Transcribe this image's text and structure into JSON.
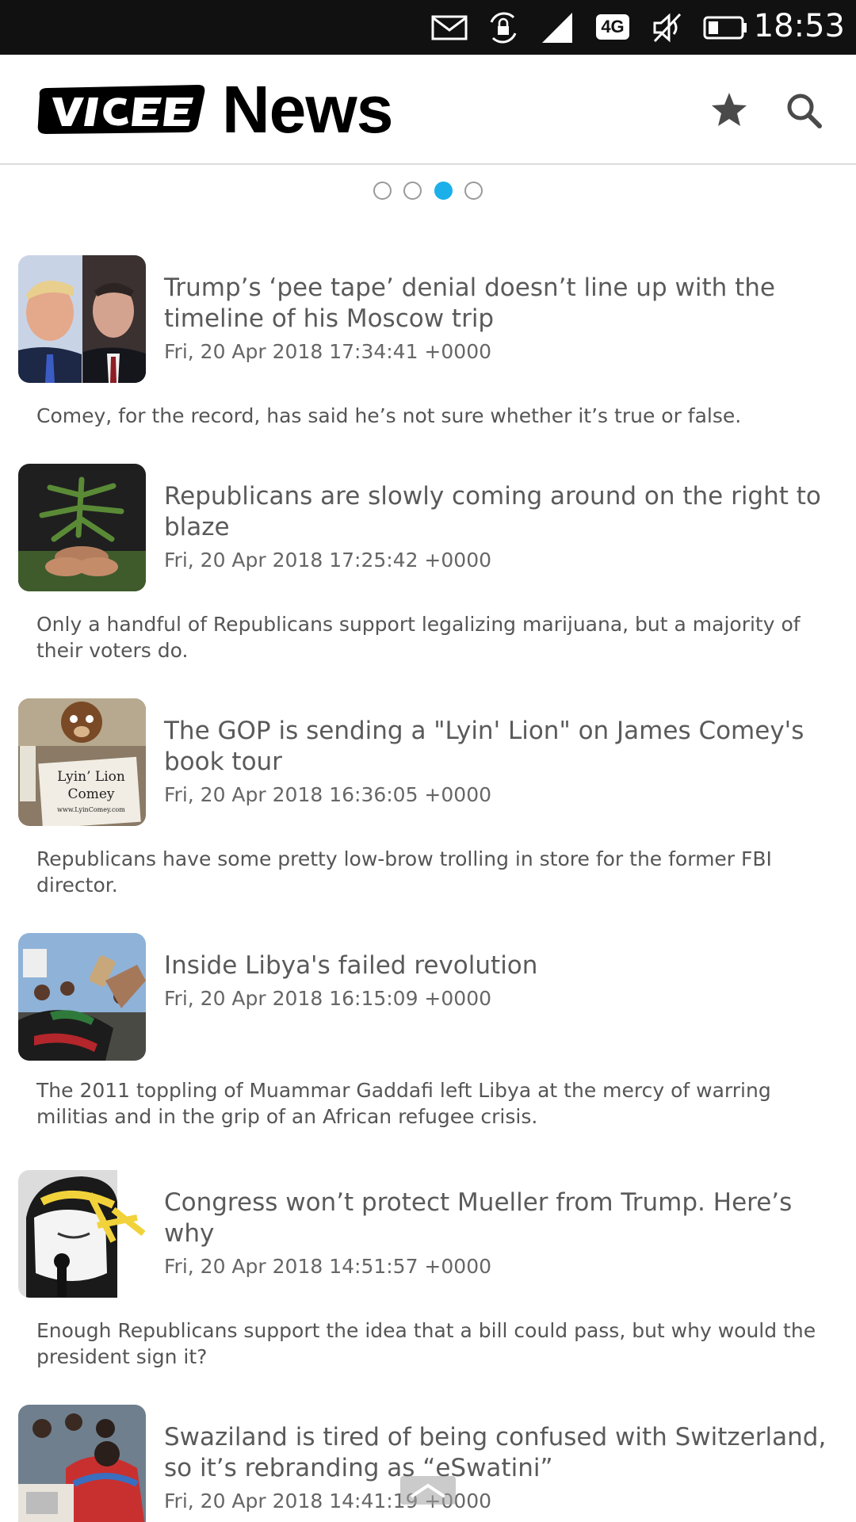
{
  "status_bar": {
    "time": "18:53",
    "network_badge": "4G",
    "icons": [
      "mail-icon",
      "screen-rotation-lock-icon",
      "signal-icon",
      "network-4g-icon",
      "mute-icon",
      "battery-icon"
    ]
  },
  "header": {
    "brand_word": "News",
    "logo_name": "VICE",
    "actions": [
      "star-icon",
      "search-icon"
    ]
  },
  "pager": {
    "count": 4,
    "active_index": 2,
    "active_color": "#1bb0ea"
  },
  "articles": [
    {
      "title": "Trump’s ‘pee tape’ denial doesn’t line up with the timeline of his Moscow trip",
      "date": "Fri, 20 Apr 2018 17:34:41 +0000",
      "description": "Comey, for the record, has said he’s not sure whether it’s true or false."
    },
    {
      "title": "Republicans are slowly coming around on the right to blaze",
      "date": "Fri, 20 Apr 2018 17:25:42 +0000",
      "description": "Only a handful of Republicans support legalizing marijuana, but a majority of their voters do."
    },
    {
      "title": "The GOP is sending a \"Lyin' Lion\" on James Comey's book tour",
      "date": "Fri, 20 Apr 2018 16:36:05 +0000",
      "description": "Republicans have some pretty low-brow trolling in store for the former FBI director.",
      "thumb_sign": [
        "Lyin’ Lion",
        "Comey",
        "www.LyinComey.com"
      ]
    },
    {
      "title": "Inside Libya's failed revolution",
      "date": "Fri, 20 Apr 2018 16:15:09 +0000",
      "description": "The 2011 toppling of Muammar Gaddafi left Libya at the mercy of warring militias and in the grip of an African refugee crisis."
    },
    {
      "title": "Congress won’t protect Mueller from Trump. Here’s why",
      "date": "Fri, 20 Apr 2018 14:51:57 +0000",
      "description": "Enough Republicans support the idea that a bill could pass, but why would the president sign it?"
    },
    {
      "title": "Swaziland is tired of being confused with Switzerland, so it’s rebranding as “eSwatini”",
      "date": "Fri, 20 Apr 2018 14:41:19 +0000",
      "description": ""
    }
  ],
  "colors": {
    "status_bar_bg": "#111111",
    "accent": "#1bb0ea",
    "text": "#5a5a5a"
  }
}
